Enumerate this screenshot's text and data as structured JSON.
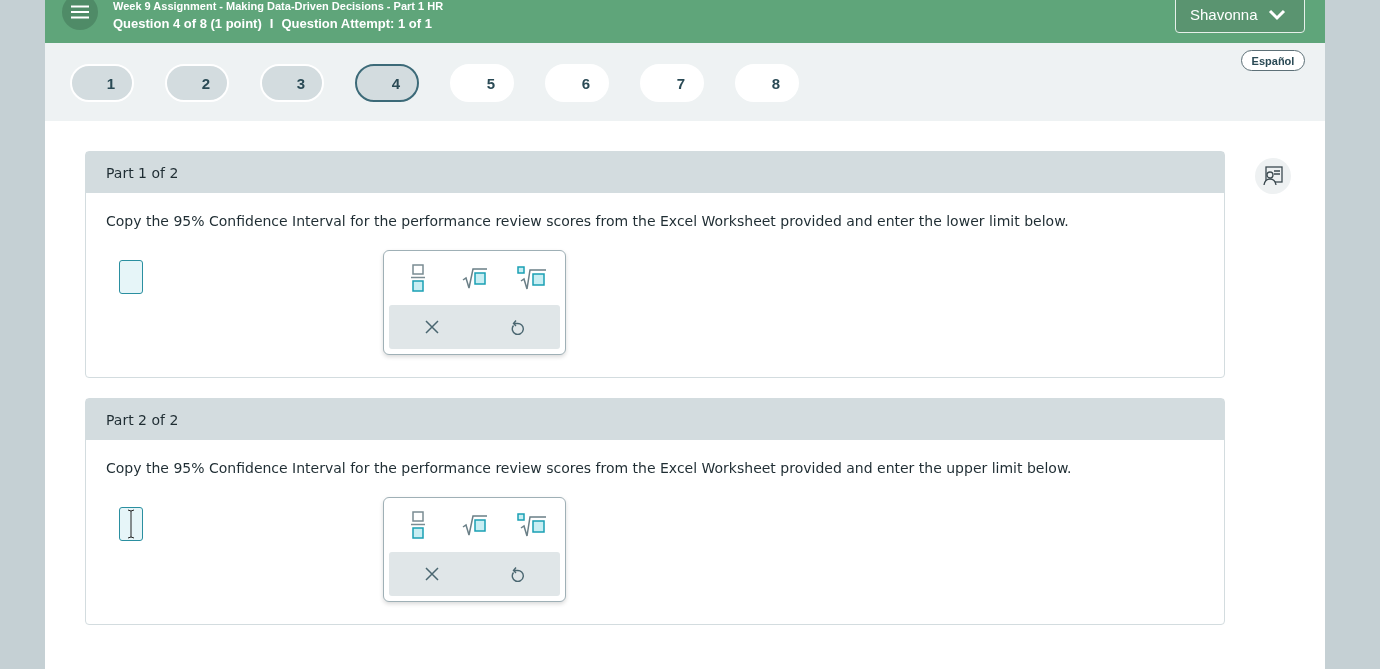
{
  "header": {
    "assignment_title": "Week 9 Assignment - Making Data-Driven Decisions - Part 1 HR",
    "question_info": "Question 4 of 8 (1 point)",
    "separator": "I",
    "attempt_info": "Question Attempt: 1 of 1",
    "user_menu": "Shavonna"
  },
  "language_button": "Español",
  "questions": [
    {
      "label": "1",
      "visited": true,
      "selected": false
    },
    {
      "label": "2",
      "visited": true,
      "selected": false
    },
    {
      "label": "3",
      "visited": true,
      "selected": false
    },
    {
      "label": "4",
      "visited": true,
      "selected": true
    },
    {
      "label": "5",
      "visited": false,
      "selected": false
    },
    {
      "label": "6",
      "visited": false,
      "selected": false
    },
    {
      "label": "7",
      "visited": false,
      "selected": false
    },
    {
      "label": "8",
      "visited": false,
      "selected": false
    }
  ],
  "parts": [
    {
      "title": "Part 1 of 2",
      "prompt": "Copy the 95% Confidence Interval for the performance review scores from the Excel Worksheet provided and enter the lower limit below.",
      "answer": {
        "focused": false
      },
      "palette": {
        "tools": [
          {
            "kind": "fraction"
          },
          {
            "kind": "sqrt"
          },
          {
            "kind": "nthroot"
          }
        ],
        "actions": [
          {
            "kind": "clear"
          },
          {
            "kind": "undo"
          }
        ]
      }
    },
    {
      "title": "Part 2 of 2",
      "prompt": "Copy the 95% Confidence Interval for the performance review scores from the Excel Worksheet provided and enter the upper limit below.",
      "answer": {
        "focused": true
      },
      "palette": {
        "tools": [
          {
            "kind": "fraction"
          },
          {
            "kind": "sqrt"
          },
          {
            "kind": "nthroot"
          }
        ],
        "actions": [
          {
            "kind": "clear"
          },
          {
            "kind": "undo"
          }
        ]
      }
    }
  ]
}
